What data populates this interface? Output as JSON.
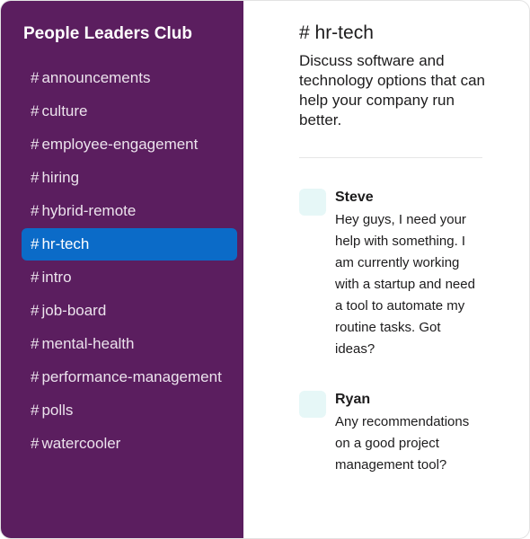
{
  "workspace": {
    "name": "People Leaders Club"
  },
  "channel_prefix": "#",
  "channels": [
    {
      "label": "announcements",
      "active": false
    },
    {
      "label": "culture",
      "active": false
    },
    {
      "label": "employee-engagement",
      "active": false
    },
    {
      "label": "hiring",
      "active": false
    },
    {
      "label": "hybrid-remote",
      "active": false
    },
    {
      "label": "hr-tech",
      "active": true
    },
    {
      "label": "intro",
      "active": false
    },
    {
      "label": "job-board",
      "active": false
    },
    {
      "label": "mental-health",
      "active": false
    },
    {
      "label": "performance-management",
      "active": false
    },
    {
      "label": "polls",
      "active": false
    },
    {
      "label": "watercooler",
      "active": false
    }
  ],
  "main": {
    "title": "# hr-tech",
    "description": "Discuss software and technology options that can help your company run better."
  },
  "messages": [
    {
      "author": "Steve",
      "text": "Hey guys, I need your help with something. I am currently working with a startup and need a tool to automate my routine tasks. Got ideas?"
    },
    {
      "author": "Ryan",
      "text": "Any recommendations on a good project management tool?"
    }
  ],
  "colors": {
    "sidebar_bg": "#5b1e5f",
    "active_channel_bg": "#0b6bc8",
    "avatar_bg": "#e6f7f7"
  }
}
